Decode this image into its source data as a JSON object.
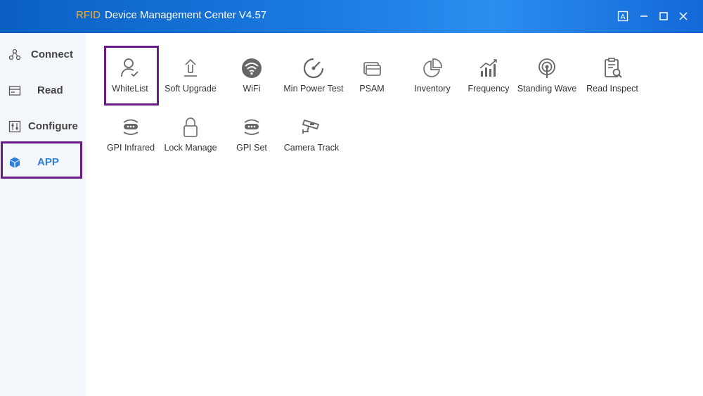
{
  "titlebar": {
    "brand": "RFID",
    "title": "Device Management Center V4.57",
    "buttons": [
      "translate-icon",
      "minimize-icon",
      "maximize-icon",
      "close-icon"
    ]
  },
  "sidebar": {
    "items": [
      {
        "label": "Connect",
        "icon": "network-nodes-icon"
      },
      {
        "label": "Read",
        "icon": "card-reader-icon"
      },
      {
        "label": "Configure",
        "icon": "sliders-icon"
      },
      {
        "label": "APP",
        "icon": "cube-icon",
        "active": true
      }
    ]
  },
  "apps": [
    {
      "label": "WhiteList",
      "icon": "user-check-icon"
    },
    {
      "label": "Soft Upgrade",
      "icon": "upload-icon"
    },
    {
      "label": "WiFi",
      "icon": "wifi-icon"
    },
    {
      "label": "Min Power Test",
      "icon": "gauge-icon"
    },
    {
      "label": "PSAM",
      "icon": "card-stack-icon"
    },
    {
      "label": "Inventory",
      "icon": "pie-chart-icon"
    },
    {
      "label": "Frequency",
      "icon": "bar-trend-icon"
    },
    {
      "label": "Standing Wave",
      "icon": "signal-pin-icon"
    },
    {
      "label": "Read Inspect",
      "icon": "clipboard-search-icon"
    },
    {
      "label": "GPI Infrared",
      "icon": "sensor-icon"
    },
    {
      "label": "Lock Manage",
      "icon": "lock-icon"
    },
    {
      "label": "GPI Set",
      "icon": "sensor-icon"
    },
    {
      "label": "Camera Track",
      "icon": "camera-icon"
    }
  ],
  "colors": {
    "titlebar": "#1a7ae0",
    "brand": "#f2b233",
    "active": "#2d7fd8",
    "highlight": "#6a1b8a",
    "sidebar_bg": "#f3f6fb"
  }
}
